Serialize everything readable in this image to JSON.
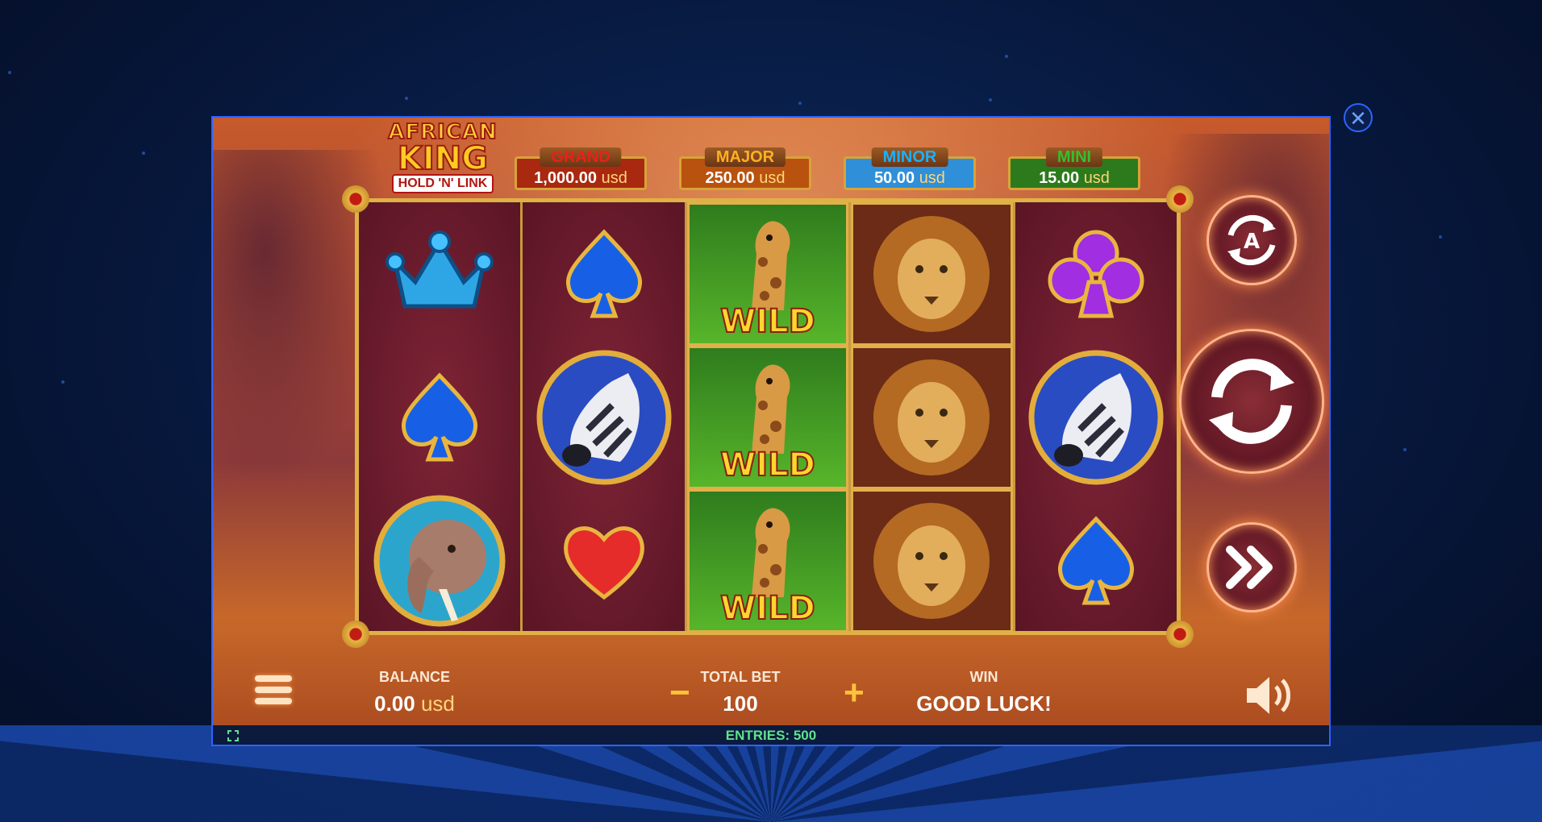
{
  "game": {
    "logo": {
      "line1": "AFRICAN",
      "line2": "KING",
      "line3": "HOLD 'N' LINK"
    },
    "jackpots": [
      {
        "label": "GRAND",
        "amount": "1,000.00",
        "currency": "usd",
        "label_color": "#c8161b",
        "bg": "#b32a14"
      },
      {
        "label": "MAJOR",
        "amount": "250.00",
        "currency": "usd",
        "label_color": "#f0a020",
        "bg": "#c55a12"
      },
      {
        "label": "MINOR",
        "amount": "50.00",
        "currency": "usd",
        "label_color": "#1aa3f0",
        "bg": "#2d8fdc"
      },
      {
        "label": "MINI",
        "amount": "15.00",
        "currency": "usd",
        "label_color": "#2fa72a",
        "bg": "#2e7d1d"
      }
    ],
    "reels": [
      [
        "crown-symbol",
        "spade-symbol",
        "elephant-symbol"
      ],
      [
        "spade-symbol",
        "zebra-symbol",
        "heart-symbol"
      ],
      [
        "wild-giraffe-symbol",
        "wild-giraffe-symbol",
        "wild-giraffe-symbol"
      ],
      [
        "lion-symbol",
        "lion-symbol",
        "lion-symbol"
      ],
      [
        "club-symbol",
        "zebra-symbol",
        "spade-symbol"
      ]
    ],
    "wild_text": "WILD",
    "balance": {
      "label": "BALANCE",
      "amount": "0.00",
      "currency": "usd"
    },
    "total_bet": {
      "label": "TOTAL BET",
      "value": "100",
      "minus": "−",
      "plus": "+"
    },
    "win": {
      "label": "WIN",
      "value": "GOOD LUCK!"
    },
    "entries": "ENTRIES: 500",
    "close_symbol": "✕",
    "colors": {
      "frame_border": "#2d64ff",
      "gold": "#e0b146",
      "accent_orange": "#ff8c4a"
    }
  }
}
